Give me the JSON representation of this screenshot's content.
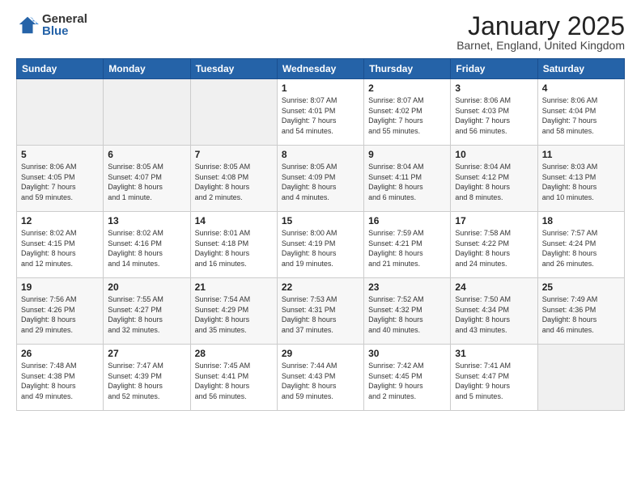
{
  "logo": {
    "general": "General",
    "blue": "Blue"
  },
  "header": {
    "month": "January 2025",
    "location": "Barnet, England, United Kingdom"
  },
  "weekdays": [
    "Sunday",
    "Monday",
    "Tuesday",
    "Wednesday",
    "Thursday",
    "Friday",
    "Saturday"
  ],
  "weeks": [
    [
      {
        "day": "",
        "info": ""
      },
      {
        "day": "",
        "info": ""
      },
      {
        "day": "",
        "info": ""
      },
      {
        "day": "1",
        "info": "Sunrise: 8:07 AM\nSunset: 4:01 PM\nDaylight: 7 hours\nand 54 minutes."
      },
      {
        "day": "2",
        "info": "Sunrise: 8:07 AM\nSunset: 4:02 PM\nDaylight: 7 hours\nand 55 minutes."
      },
      {
        "day": "3",
        "info": "Sunrise: 8:06 AM\nSunset: 4:03 PM\nDaylight: 7 hours\nand 56 minutes."
      },
      {
        "day": "4",
        "info": "Sunrise: 8:06 AM\nSunset: 4:04 PM\nDaylight: 7 hours\nand 58 minutes."
      }
    ],
    [
      {
        "day": "5",
        "info": "Sunrise: 8:06 AM\nSunset: 4:05 PM\nDaylight: 7 hours\nand 59 minutes."
      },
      {
        "day": "6",
        "info": "Sunrise: 8:05 AM\nSunset: 4:07 PM\nDaylight: 8 hours\nand 1 minute."
      },
      {
        "day": "7",
        "info": "Sunrise: 8:05 AM\nSunset: 4:08 PM\nDaylight: 8 hours\nand 2 minutes."
      },
      {
        "day": "8",
        "info": "Sunrise: 8:05 AM\nSunset: 4:09 PM\nDaylight: 8 hours\nand 4 minutes."
      },
      {
        "day": "9",
        "info": "Sunrise: 8:04 AM\nSunset: 4:11 PM\nDaylight: 8 hours\nand 6 minutes."
      },
      {
        "day": "10",
        "info": "Sunrise: 8:04 AM\nSunset: 4:12 PM\nDaylight: 8 hours\nand 8 minutes."
      },
      {
        "day": "11",
        "info": "Sunrise: 8:03 AM\nSunset: 4:13 PM\nDaylight: 8 hours\nand 10 minutes."
      }
    ],
    [
      {
        "day": "12",
        "info": "Sunrise: 8:02 AM\nSunset: 4:15 PM\nDaylight: 8 hours\nand 12 minutes."
      },
      {
        "day": "13",
        "info": "Sunrise: 8:02 AM\nSunset: 4:16 PM\nDaylight: 8 hours\nand 14 minutes."
      },
      {
        "day": "14",
        "info": "Sunrise: 8:01 AM\nSunset: 4:18 PM\nDaylight: 8 hours\nand 16 minutes."
      },
      {
        "day": "15",
        "info": "Sunrise: 8:00 AM\nSunset: 4:19 PM\nDaylight: 8 hours\nand 19 minutes."
      },
      {
        "day": "16",
        "info": "Sunrise: 7:59 AM\nSunset: 4:21 PM\nDaylight: 8 hours\nand 21 minutes."
      },
      {
        "day": "17",
        "info": "Sunrise: 7:58 AM\nSunset: 4:22 PM\nDaylight: 8 hours\nand 24 minutes."
      },
      {
        "day": "18",
        "info": "Sunrise: 7:57 AM\nSunset: 4:24 PM\nDaylight: 8 hours\nand 26 minutes."
      }
    ],
    [
      {
        "day": "19",
        "info": "Sunrise: 7:56 AM\nSunset: 4:26 PM\nDaylight: 8 hours\nand 29 minutes."
      },
      {
        "day": "20",
        "info": "Sunrise: 7:55 AM\nSunset: 4:27 PM\nDaylight: 8 hours\nand 32 minutes."
      },
      {
        "day": "21",
        "info": "Sunrise: 7:54 AM\nSunset: 4:29 PM\nDaylight: 8 hours\nand 35 minutes."
      },
      {
        "day": "22",
        "info": "Sunrise: 7:53 AM\nSunset: 4:31 PM\nDaylight: 8 hours\nand 37 minutes."
      },
      {
        "day": "23",
        "info": "Sunrise: 7:52 AM\nSunset: 4:32 PM\nDaylight: 8 hours\nand 40 minutes."
      },
      {
        "day": "24",
        "info": "Sunrise: 7:50 AM\nSunset: 4:34 PM\nDaylight: 8 hours\nand 43 minutes."
      },
      {
        "day": "25",
        "info": "Sunrise: 7:49 AM\nSunset: 4:36 PM\nDaylight: 8 hours\nand 46 minutes."
      }
    ],
    [
      {
        "day": "26",
        "info": "Sunrise: 7:48 AM\nSunset: 4:38 PM\nDaylight: 8 hours\nand 49 minutes."
      },
      {
        "day": "27",
        "info": "Sunrise: 7:47 AM\nSunset: 4:39 PM\nDaylight: 8 hours\nand 52 minutes."
      },
      {
        "day": "28",
        "info": "Sunrise: 7:45 AM\nSunset: 4:41 PM\nDaylight: 8 hours\nand 56 minutes."
      },
      {
        "day": "29",
        "info": "Sunrise: 7:44 AM\nSunset: 4:43 PM\nDaylight: 8 hours\nand 59 minutes."
      },
      {
        "day": "30",
        "info": "Sunrise: 7:42 AM\nSunset: 4:45 PM\nDaylight: 9 hours\nand 2 minutes."
      },
      {
        "day": "31",
        "info": "Sunrise: 7:41 AM\nSunset: 4:47 PM\nDaylight: 9 hours\nand 5 minutes."
      },
      {
        "day": "",
        "info": ""
      }
    ]
  ]
}
